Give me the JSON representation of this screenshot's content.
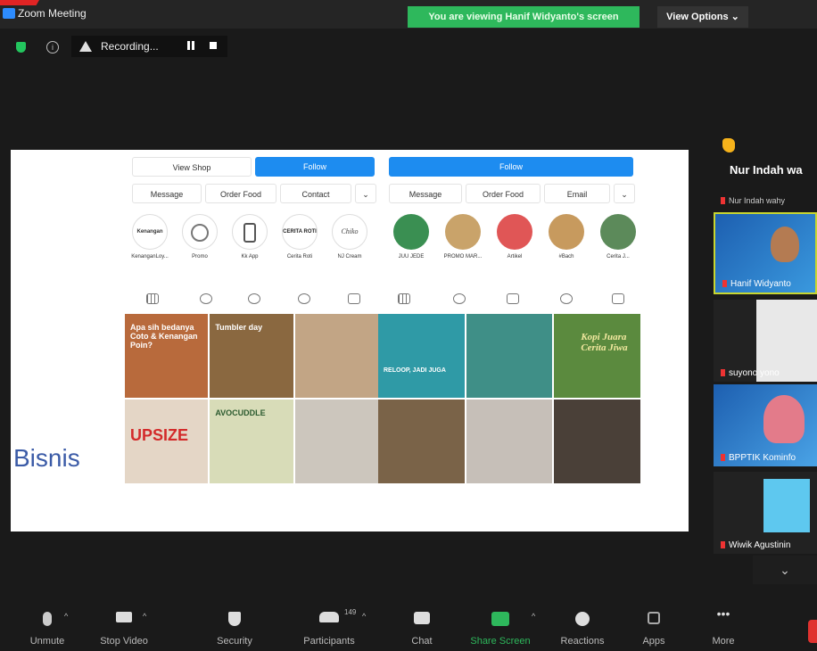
{
  "window": {
    "title": "Zoom Meeting"
  },
  "banner": {
    "text": "You are viewing Hanif Widyanto's screen"
  },
  "view_options": {
    "label": "View Options ⌄"
  },
  "recording": {
    "label": "Recording..."
  },
  "shared_screen": {
    "left_profile": {
      "buttons": {
        "view_shop": "View Shop",
        "follow": "Follow",
        "message": "Message",
        "order_food": "Order Food",
        "contact": "Contact",
        "more": "⌄"
      },
      "highlights": [
        "KenanganLoy...",
        "Promo",
        "Kk App",
        "Cerita Roti",
        "NJ Cream"
      ],
      "highlight_logos": [
        "Kenangan",
        "",
        "",
        "CERITA ROTI",
        "Chiko"
      ],
      "grid": [
        {
          "text": "Apa sih bedanya Coto & Kenangan Poin?",
          "color": "#b86a3c"
        },
        {
          "text": "Tumbler day",
          "color": "#8a6840"
        },
        {
          "text": "",
          "color": "#c2a585"
        },
        {
          "text": "UPSIZE",
          "color": "#e4d6c6"
        },
        {
          "text": "AVOCUDDLE",
          "color": "#d8dcb8"
        },
        {
          "text": "",
          "color": "#ccc6bd"
        }
      ]
    },
    "right_profile": {
      "buttons": {
        "follow": "Follow",
        "message": "Message",
        "order_food": "Order Food",
        "email": "Email",
        "more": "⌄"
      },
      "highlights": [
        "JUU JEDE",
        "PROMO MAR...",
        "Artikel",
        "#Bach",
        "Cerita J..."
      ],
      "grid": [
        {
          "text": "RELOOP, JADI JUGA",
          "color": "#2f9aa6"
        },
        {
          "text": "",
          "color": "#3f8f87"
        },
        {
          "text": "Kopi Juara Cerita Jiwa",
          "color": "#5b8a3e"
        },
        {
          "text": "",
          "color": "#7a6348"
        },
        {
          "text": "",
          "color": "#c6bfb8"
        },
        {
          "text": "",
          "color": "#4a4038"
        }
      ]
    },
    "caption": "Bisnis"
  },
  "sidebar": {
    "raised_hand_name": "Nur Indah wa",
    "name_row": "Nur Indah wahy",
    "tiles": [
      {
        "label": "Hanif Widyanto",
        "bg": "#2a6fbf"
      },
      {
        "label": "suyono yono",
        "bg": "#2b2b2b"
      },
      {
        "label": "BPPTIK Kominfo",
        "bg": "#2a6fbf"
      },
      {
        "label": "Wiwik Agustinin",
        "bg": "#2b2b2b"
      }
    ],
    "scroll": "⌄"
  },
  "toolbar": {
    "items": [
      "Unmute",
      "Stop Video",
      "Security",
      "Participants",
      "Chat",
      "Share Screen",
      "Reactions",
      "Apps",
      "More"
    ],
    "participants_count": "149"
  }
}
